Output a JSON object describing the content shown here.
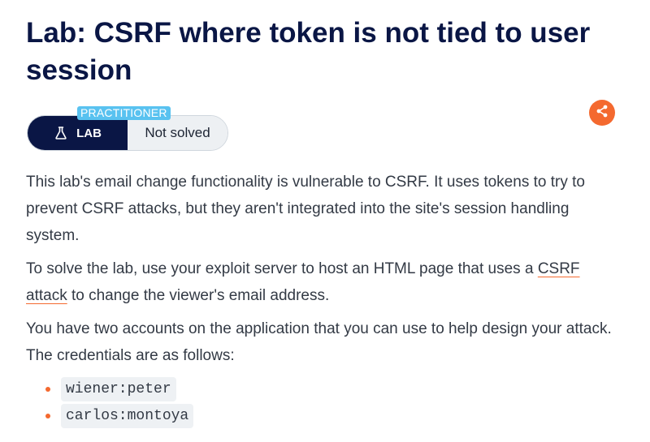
{
  "lab": {
    "title": "Lab: CSRF where token is not tied to user session",
    "level": "PRACTITIONER",
    "type_label": "LAB",
    "status": "Not solved"
  },
  "description": {
    "p1": "This lab's email change functionality is vulnerable to CSRF. It uses tokens to try to prevent CSRF attacks, but they aren't integrated into the site's session handling system.",
    "p2_before": "To solve the lab, use your exploit server to host an HTML page that uses a ",
    "p2_link": "CSRF attack",
    "p2_after": " to change the viewer's email address.",
    "p3": "You have two accounts on the application that you can use to help design your attack. The credentials are as follows:",
    "credentials": [
      "wiener:peter",
      "carlos:montoya"
    ]
  },
  "icons": {
    "lab_icon": "flask-icon",
    "share_icon": "share-icon"
  },
  "colors": {
    "navy": "#0a1645",
    "accent": "#f4692f",
    "level_tag": "#59c2f0"
  }
}
